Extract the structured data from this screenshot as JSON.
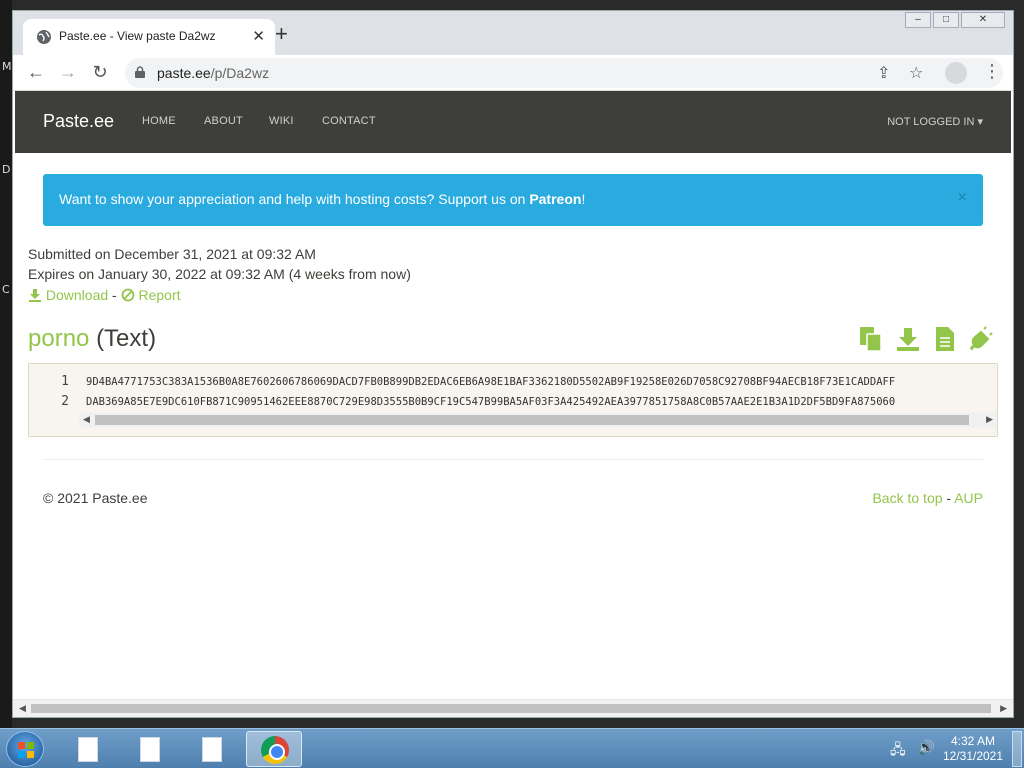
{
  "desktop": {
    "edge_letters": [
      "M",
      "D",
      "C"
    ]
  },
  "browser": {
    "tab_title": "Paste.ee - View paste Da2wz",
    "url_host": "paste.ee",
    "url_path": "/p/Da2wz",
    "window_controls": {
      "minimize": "–",
      "maximize": "□",
      "close": "✕"
    }
  },
  "site": {
    "brand": "Paste.ee",
    "nav": [
      "HOME",
      "ABOUT",
      "WIKI",
      "CONTACT"
    ],
    "account": "NOT LOGGED IN ▾",
    "alert": {
      "text": "Want to show your appreciation and help with hosting costs? Support us on ",
      "link": "Patreon",
      "suffix": "!",
      "close": "×"
    },
    "submitted": "Submitted on December 31, 2021 at 09:32 AM",
    "expires": "Expires on January 30, 2022 at 09:32 AM (4 weeks from now)",
    "download_label": "Download",
    "report_label": "Report",
    "separator": "-",
    "paste_name": "porno",
    "paste_type": "(Text)",
    "code_lines": [
      {
        "num": "1",
        "text": "9D4BA4771753C383A1536B0A8E7602606786069DACD7FB0B899DB2EDAC6EB6A98E1BAF3362180D5502AB9F19258E026D7058C92708BF94AECB18F73E1CADDAFF"
      },
      {
        "num": "2",
        "text": "DAB369A85E7E9DC610FB871C90951462EEE8870C729E98D3555B0B9CF19C547B99BA5AF03F3A425492AEA3977851758A8C0B57AAE2E1B3A1D2DF5BD9FA875060"
      }
    ],
    "footer_copyright": "© 2021 Paste.ee",
    "footer_back_to_top": "Back to top",
    "footer_aup": "AUP"
  },
  "taskbar": {
    "time": "4:32 AM",
    "date": "12/31/2021"
  },
  "colors": {
    "navbar": "#3e3f3a",
    "accent": "#93c54b",
    "alert": "#29abe0"
  }
}
